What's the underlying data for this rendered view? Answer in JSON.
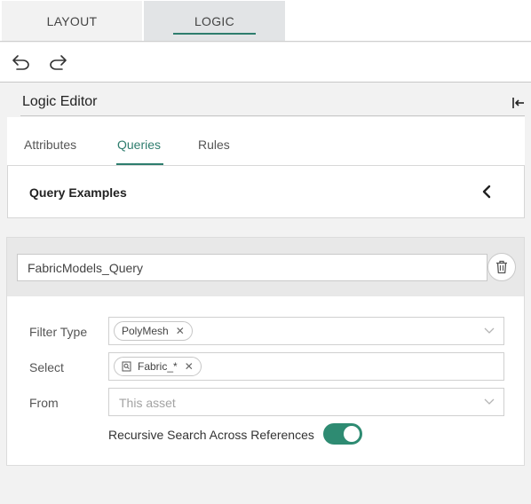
{
  "top_tabs": [
    {
      "label": "LAYOUT",
      "active": false
    },
    {
      "label": "LOGIC",
      "active": true
    }
  ],
  "history": {
    "undo_icon": "undo-arrow-icon",
    "redo_icon": "redo-arrow-icon"
  },
  "editor": {
    "title": "Logic Editor",
    "collapse_icon": "collapse-to-left-icon"
  },
  "sub_tabs": [
    {
      "label": "Attributes",
      "active": false
    },
    {
      "label": "Queries",
      "active": true
    },
    {
      "label": "Rules",
      "active": false
    }
  ],
  "examples": {
    "label": "Query Examples",
    "icon": "chevron-left-icon"
  },
  "query": {
    "name_value": "FabricModels_Query",
    "delete_icon": "trash-icon",
    "filter_type": {
      "label": "Filter Type",
      "chip": "PolyMesh"
    },
    "select": {
      "label": "Select",
      "chip": "Fabric_*",
      "chip_icon": "search-document-icon"
    },
    "from": {
      "label": "From",
      "placeholder": "This asset"
    },
    "recursive": {
      "label": "Recursive Search Across References",
      "enabled": true
    }
  },
  "colors": {
    "accent": "#2e7d6e",
    "toggle_on": "#2e8b72"
  }
}
